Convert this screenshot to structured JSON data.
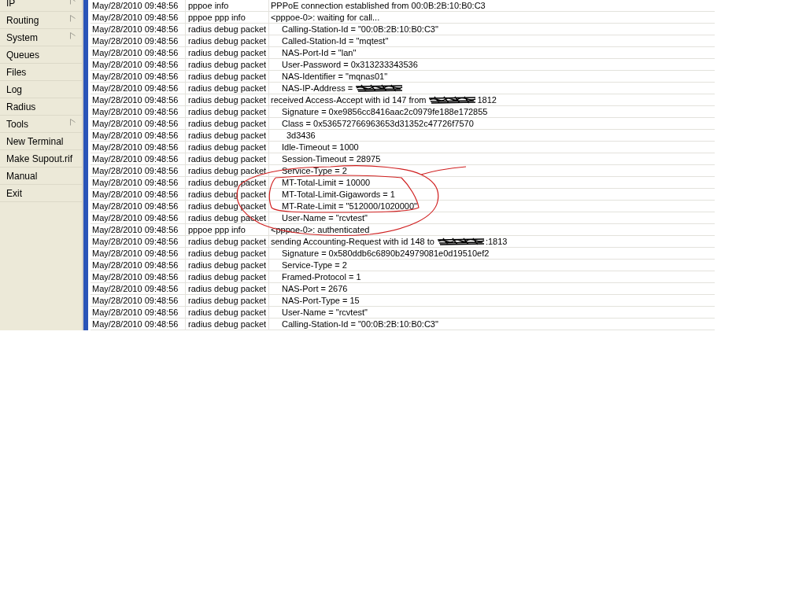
{
  "menu": [
    {
      "label": "IP",
      "submenu": true
    },
    {
      "label": "Routing",
      "submenu": true
    },
    {
      "label": "System",
      "submenu": true
    },
    {
      "label": "Queues",
      "submenu": false
    },
    {
      "label": "Files",
      "submenu": false
    },
    {
      "label": "Log",
      "submenu": false
    },
    {
      "label": "Radius",
      "submenu": false
    },
    {
      "label": "Tools",
      "submenu": true
    },
    {
      "label": "New Terminal",
      "submenu": false
    },
    {
      "label": "Make Supout.rif",
      "submenu": false
    },
    {
      "label": "Manual",
      "submenu": false
    },
    {
      "label": "Exit",
      "submenu": false
    }
  ],
  "log": {
    "rows": [
      {
        "time": "May/28/2010 09:48:56",
        "topics": "pppoe info",
        "kind": "event",
        "message": "PPPoE connection established from 00:0B:2B:10:B0:C3"
      },
      {
        "time": "May/28/2010 09:48:56",
        "topics": "pppoe ppp info",
        "kind": "event",
        "message": "<pppoe-0>: waiting for call..."
      },
      {
        "time": "May/28/2010 09:48:56",
        "topics": "radius debug packet",
        "kind": "attribute",
        "message": "Calling-Station-Id = \"00:0B:2B:10:B0:C3\""
      },
      {
        "time": "May/28/2010 09:48:56",
        "topics": "radius debug packet",
        "kind": "attribute",
        "message": "Called-Station-Id = \"mqtest\""
      },
      {
        "time": "May/28/2010 09:48:56",
        "topics": "radius debug packet",
        "kind": "attribute",
        "message": "NAS-Port-Id = \"lan\""
      },
      {
        "time": "May/28/2010 09:48:56",
        "topics": "radius debug packet",
        "kind": "attribute",
        "message": "User-Password = 0x313233343536"
      },
      {
        "time": "May/28/2010 09:48:56",
        "topics": "radius debug packet",
        "kind": "attribute",
        "message": "NAS-Identifier = \"mqnas01\""
      },
      {
        "time": "May/28/2010 09:48:56",
        "topics": "radius debug packet",
        "kind": "attribute",
        "message": "NAS-IP-Address =",
        "redacted": true
      },
      {
        "time": "May/28/2010 09:48:56",
        "topics": "radius debug packet",
        "kind": "event",
        "message": "received Access-Accept with id 147 from",
        "redacted": true,
        "suffix": "1812"
      },
      {
        "time": "May/28/2010 09:48:56",
        "topics": "radius debug packet",
        "kind": "attribute",
        "message": "Signature = 0xe9856cc8416aac2c0979fe188e172855"
      },
      {
        "time": "May/28/2010 09:48:56",
        "topics": "radius debug packet",
        "kind": "attribute",
        "message": "Class = 0x536572766963653d31352c47726f7570"
      },
      {
        "time": "May/28/2010 09:48:56",
        "topics": "radius debug packet",
        "kind": "continuation",
        "message": "3d3436"
      },
      {
        "time": "May/28/2010 09:48:56",
        "topics": "radius debug packet",
        "kind": "attribute",
        "message": "Idle-Timeout = 1000"
      },
      {
        "time": "May/28/2010 09:48:56",
        "topics": "radius debug packet",
        "kind": "attribute",
        "message": "Session-Timeout = 28975"
      },
      {
        "time": "May/28/2010 09:48:56",
        "topics": "radius debug packet",
        "kind": "attribute",
        "message": "Service-Type = 2"
      },
      {
        "time": "May/28/2010 09:48:56",
        "topics": "radius debug packet",
        "kind": "attribute",
        "message": "MT-Total-Limit = 10000"
      },
      {
        "time": "May/28/2010 09:48:56",
        "topics": "radius debug packet",
        "kind": "attribute",
        "message": "MT-Total-Limit-Gigawords = 1"
      },
      {
        "time": "May/28/2010 09:48:56",
        "topics": "radius debug packet",
        "kind": "attribute",
        "message": "MT-Rate-Limit = \"512000/1020000\""
      },
      {
        "time": "May/28/2010 09:48:56",
        "topics": "radius debug packet",
        "kind": "attribute",
        "message": "User-Name = \"rcvtest\""
      },
      {
        "time": "May/28/2010 09:48:56",
        "topics": "pppoe ppp info",
        "kind": "event",
        "message": "<pppoe-0>: authenticated"
      },
      {
        "time": "May/28/2010 09:48:56",
        "topics": "radius debug packet",
        "kind": "event",
        "message": "sending Accounting-Request with id 148 to",
        "redacted": true,
        "suffix": ":1813"
      },
      {
        "time": "May/28/2010 09:48:56",
        "topics": "radius debug packet",
        "kind": "attribute",
        "message": "Signature = 0x580ddb6c6890b24979081e0d19510ef2"
      },
      {
        "time": "May/28/2010 09:48:56",
        "topics": "radius debug packet",
        "kind": "attribute",
        "message": "Service-Type = 2"
      },
      {
        "time": "May/28/2010 09:48:56",
        "topics": "radius debug packet",
        "kind": "attribute",
        "message": "Framed-Protocol = 1"
      },
      {
        "time": "May/28/2010 09:48:56",
        "topics": "radius debug packet",
        "kind": "attribute",
        "message": "NAS-Port = 2676"
      },
      {
        "time": "May/28/2010 09:48:56",
        "topics": "radius debug packet",
        "kind": "attribute",
        "message": "NAS-Port-Type = 15"
      },
      {
        "time": "May/28/2010 09:48:56",
        "topics": "radius debug packet",
        "kind": "attribute",
        "message": "User-Name = \"rcvtest\""
      },
      {
        "time": "May/28/2010 09:48:56",
        "topics": "radius debug packet",
        "kind": "attribute",
        "message": "Calling-Station-Id = \"00:0B:2B:10:B0:C3\""
      }
    ]
  }
}
